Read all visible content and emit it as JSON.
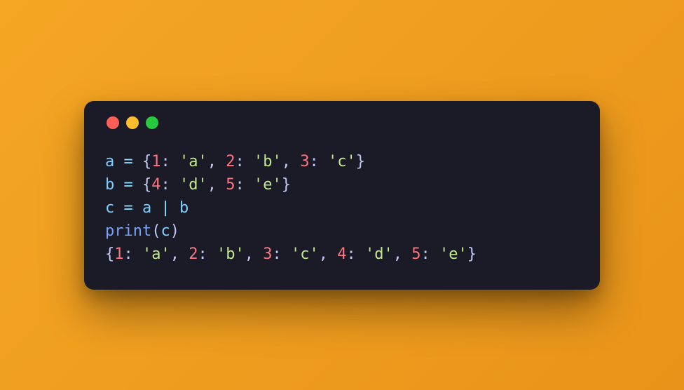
{
  "colors": {
    "bg_gradient_start": "#f5a623",
    "bg_gradient_end": "#e8941a",
    "terminal_bg": "#1a1b26",
    "traffic_red": "#ff5f56",
    "traffic_yellow": "#ffbd2e",
    "traffic_green": "#27c93f",
    "tok_var": "#7dcfff",
    "tok_op": "#89ddff",
    "tok_punct": "#c0caf5",
    "tok_num": "#ff757f",
    "tok_str": "#c3e88d",
    "tok_func": "#7aa2f7"
  },
  "code": {
    "lines": [
      [
        {
          "cls": "tok-var",
          "t": "a"
        },
        {
          "cls": "",
          "t": " "
        },
        {
          "cls": "tok-op",
          "t": "="
        },
        {
          "cls": "",
          "t": " "
        },
        {
          "cls": "tok-punct",
          "t": "{"
        },
        {
          "cls": "tok-num",
          "t": "1"
        },
        {
          "cls": "tok-punct",
          "t": ": "
        },
        {
          "cls": "tok-str",
          "t": "'a'"
        },
        {
          "cls": "tok-punct",
          "t": ", "
        },
        {
          "cls": "tok-num",
          "t": "2"
        },
        {
          "cls": "tok-punct",
          "t": ": "
        },
        {
          "cls": "tok-str",
          "t": "'b'"
        },
        {
          "cls": "tok-punct",
          "t": ", "
        },
        {
          "cls": "tok-num",
          "t": "3"
        },
        {
          "cls": "tok-punct",
          "t": ": "
        },
        {
          "cls": "tok-str",
          "t": "'c'"
        },
        {
          "cls": "tok-punct",
          "t": "}"
        }
      ],
      [
        {
          "cls": "tok-var",
          "t": "b"
        },
        {
          "cls": "",
          "t": " "
        },
        {
          "cls": "tok-op",
          "t": "="
        },
        {
          "cls": "",
          "t": " "
        },
        {
          "cls": "tok-punct",
          "t": "{"
        },
        {
          "cls": "tok-num",
          "t": "4"
        },
        {
          "cls": "tok-punct",
          "t": ": "
        },
        {
          "cls": "tok-str",
          "t": "'d'"
        },
        {
          "cls": "tok-punct",
          "t": ", "
        },
        {
          "cls": "tok-num",
          "t": "5"
        },
        {
          "cls": "tok-punct",
          "t": ": "
        },
        {
          "cls": "tok-str",
          "t": "'e'"
        },
        {
          "cls": "tok-punct",
          "t": "}"
        }
      ],
      [
        {
          "cls": "tok-var",
          "t": "c"
        },
        {
          "cls": "",
          "t": " "
        },
        {
          "cls": "tok-op",
          "t": "="
        },
        {
          "cls": "",
          "t": " "
        },
        {
          "cls": "tok-var",
          "t": "a"
        },
        {
          "cls": "",
          "t": " "
        },
        {
          "cls": "tok-op",
          "t": "|"
        },
        {
          "cls": "",
          "t": " "
        },
        {
          "cls": "tok-var",
          "t": "b"
        }
      ],
      [
        {
          "cls": "tok-func",
          "t": "print"
        },
        {
          "cls": "tok-punct",
          "t": "("
        },
        {
          "cls": "tok-var",
          "t": "c"
        },
        {
          "cls": "tok-punct",
          "t": ")"
        }
      ],
      [
        {
          "cls": "tok-punct",
          "t": "{"
        },
        {
          "cls": "tok-num",
          "t": "1"
        },
        {
          "cls": "tok-punct",
          "t": ": "
        },
        {
          "cls": "tok-str",
          "t": "'a'"
        },
        {
          "cls": "tok-punct",
          "t": ", "
        },
        {
          "cls": "tok-num",
          "t": "2"
        },
        {
          "cls": "tok-punct",
          "t": ": "
        },
        {
          "cls": "tok-str",
          "t": "'b'"
        },
        {
          "cls": "tok-punct",
          "t": ", "
        },
        {
          "cls": "tok-num",
          "t": "3"
        },
        {
          "cls": "tok-punct",
          "t": ": "
        },
        {
          "cls": "tok-str",
          "t": "'c'"
        },
        {
          "cls": "tok-punct",
          "t": ", "
        },
        {
          "cls": "tok-num",
          "t": "4"
        },
        {
          "cls": "tok-punct",
          "t": ": "
        },
        {
          "cls": "tok-str",
          "t": "'d'"
        },
        {
          "cls": "tok-punct",
          "t": ", "
        },
        {
          "cls": "tok-num",
          "t": "5"
        },
        {
          "cls": "tok-punct",
          "t": ": "
        },
        {
          "cls": "tok-str",
          "t": "'e'"
        },
        {
          "cls": "tok-punct",
          "t": "}"
        }
      ]
    ]
  }
}
